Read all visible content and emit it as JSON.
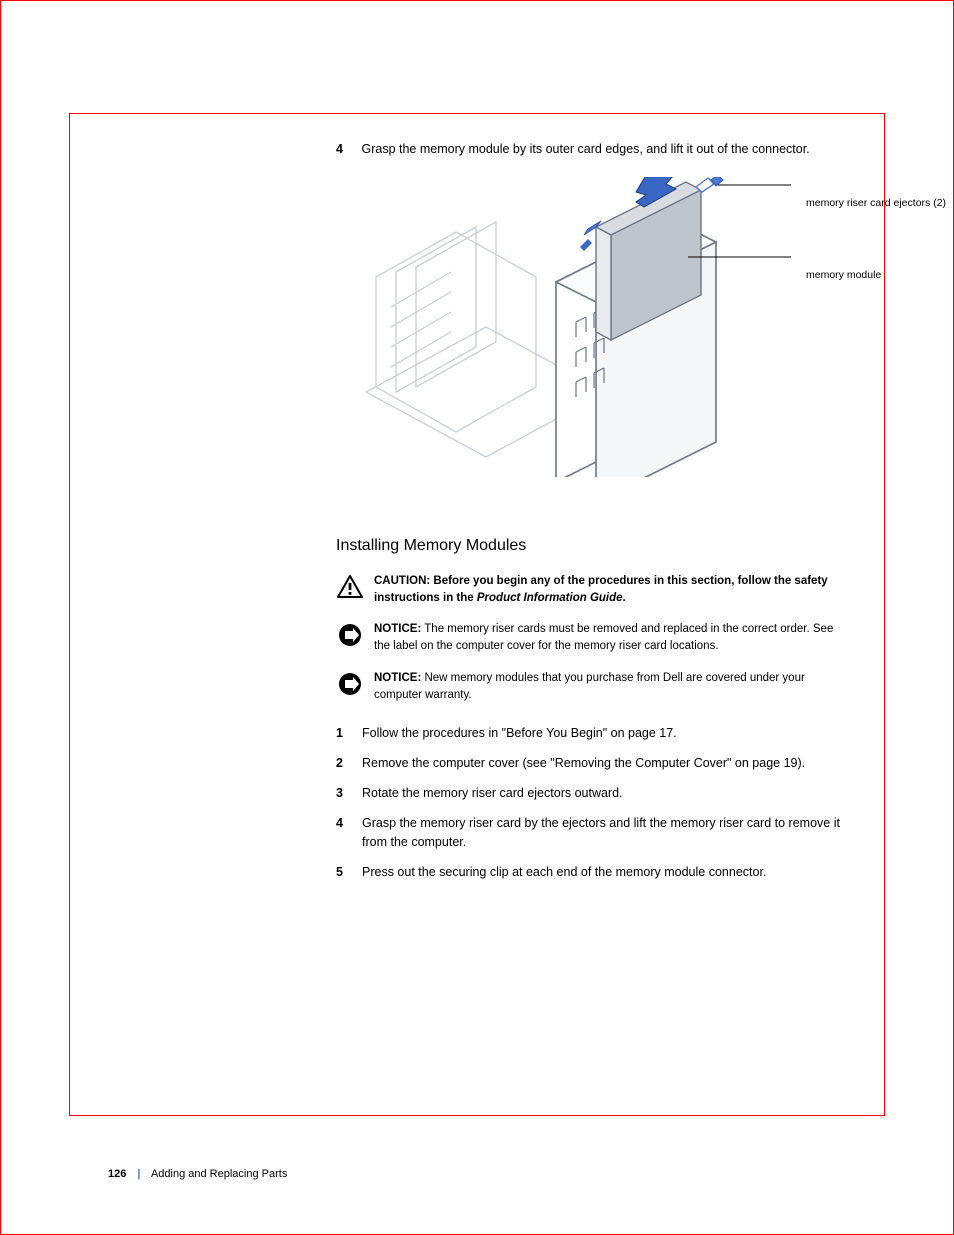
{
  "top": {
    "step4_num": "4",
    "step4_text": "Grasp the memory module by its outer card edges, and lift it out of the connector.",
    "fig_label_ejectors": "memory riser card ejectors (2)",
    "fig_label_module": "memory module"
  },
  "install": {
    "heading": "Installing Memory Modules",
    "caution_label": "CAUTION:",
    "caution_text": "Before you begin any of the procedures in this section, follow the safety instructions in the ",
    "caution_text_ital": "Product Information Guide",
    "caution_text_end": ".",
    "notice1_label": "NOTICE:",
    "notice1_text": "The memory riser cards must be removed and replaced in the correct order. See the label on the computer cover for the memory riser card locations.",
    "notice2_label": "NOTICE:",
    "notice2_text": "New memory modules that you purchase from Dell are covered under your computer warranty.",
    "steps": [
      {
        "n": "1",
        "t": "Follow the procedures in \"Before You Begin\" on page 17."
      },
      {
        "n": "2",
        "t": "Remove the computer cover (see \"Removing the Computer Cover\" on page 19)."
      },
      {
        "n": "3",
        "t": "Rotate the memory riser card ejectors outward."
      },
      {
        "n": "4",
        "t": "Grasp the memory riser card by the ejectors and lift the memory riser card to remove it from the computer."
      },
      {
        "n": "5",
        "t": "Press out the securing clip at each end of the memory module connector."
      }
    ]
  },
  "footer": {
    "page": "126",
    "sep": "|",
    "title": "Adding and Replacing Parts"
  }
}
